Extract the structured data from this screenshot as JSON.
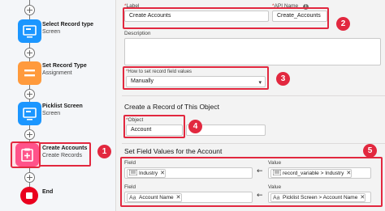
{
  "flow": {
    "nodes": [
      {
        "title": "Select Record type",
        "subtitle": "Screen"
      },
      {
        "title": "Set Record Type",
        "subtitle": "Assignment"
      },
      {
        "title": "Picklist Screen",
        "subtitle": "Screen"
      },
      {
        "title": "Create Accounts",
        "subtitle": "Create Records"
      },
      {
        "title": "End",
        "subtitle": ""
      }
    ],
    "add_glyph": "+"
  },
  "panel": {
    "label_field": {
      "required_mark": "*",
      "label": "Label",
      "value": "Create Accounts"
    },
    "api_field": {
      "required_mark": "*",
      "label": "API Name",
      "info_glyph": "i",
      "value": "Create_Accounts"
    },
    "description_label": "Description",
    "how_to_set": {
      "required_mark": "*",
      "label": "How to set record field values",
      "value": "Manually",
      "chevron": "▾"
    },
    "section_create": "Create a Record of This Object",
    "object_field": {
      "required_mark": "*",
      "label": "Object",
      "value": "Account"
    },
    "section_set_values": "Set Field Values for the Account",
    "mapping": {
      "field_label": "Field",
      "value_label": "Value",
      "arrow": "←",
      "clear_glyph": "✕",
      "rows": [
        {
          "field": "Industry",
          "value": "record_variable > Industry"
        },
        {
          "field": "Account Name",
          "value": "Picklist Screen > Account Name"
        }
      ]
    }
  },
  "annotations": [
    "1",
    "2",
    "3",
    "4",
    "5"
  ],
  "colors": {
    "callout_red": "#e2283f",
    "screen_blue": "#1b96ff",
    "assignment_orange": "#ff9a3c",
    "create_pink": "#ff538a",
    "end_red": "#ea001e"
  }
}
